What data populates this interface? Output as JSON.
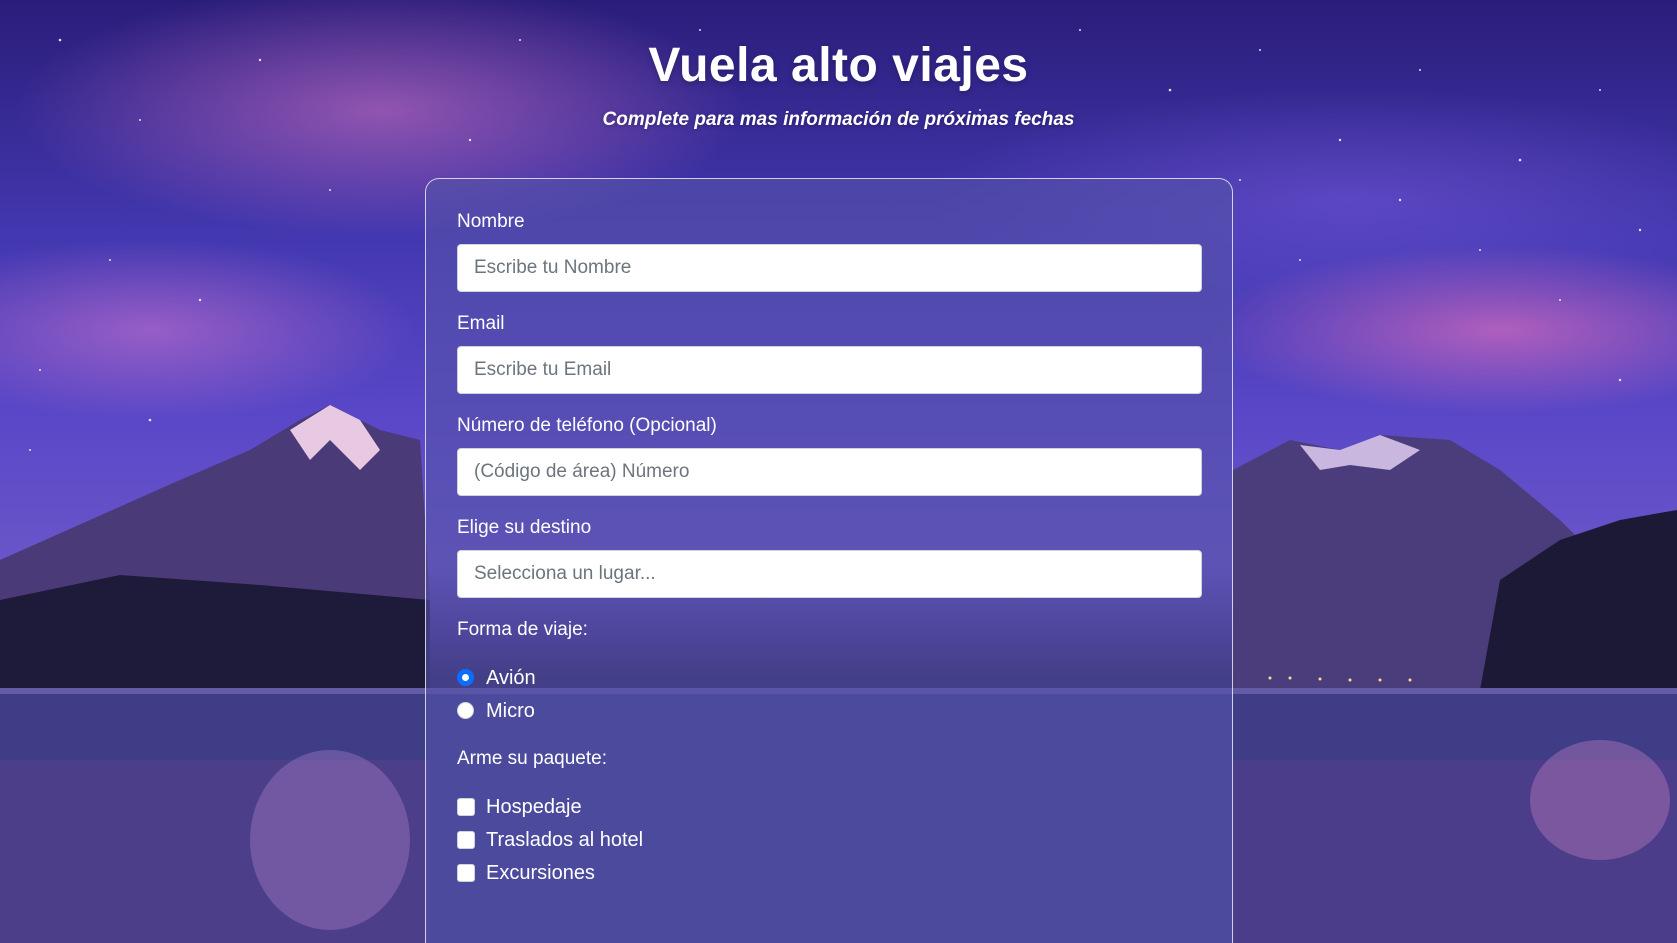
{
  "header": {
    "title": "Vuela alto viajes",
    "subtitle": "Complete para mas información de próximas fechas"
  },
  "form": {
    "name": {
      "label": "Nombre",
      "placeholder": "Escribe tu Nombre",
      "value": ""
    },
    "email": {
      "label": "Email",
      "placeholder": "Escribe tu Email",
      "value": ""
    },
    "phone": {
      "label": "Número de teléfono (Opcional)",
      "placeholder": "(Código de área) Número",
      "value": ""
    },
    "destination": {
      "label": "Elige su destino",
      "placeholder": "Selecciona un lugar...",
      "value": ""
    },
    "travel_mode": {
      "label": "Forma de viaje:",
      "options": [
        {
          "label": "Avión",
          "checked": true
        },
        {
          "label": "Micro",
          "checked": false
        }
      ]
    },
    "package": {
      "label": "Arme su paquete:",
      "options": [
        {
          "label": "Hospedaje",
          "checked": false
        },
        {
          "label": "Traslados al hotel",
          "checked": false
        },
        {
          "label": "Excursiones",
          "checked": false
        }
      ]
    }
  },
  "colors": {
    "radio_checked": "#0d6efd",
    "card_background": "rgba(85, 82, 170, 0.62)",
    "text": "#ffffff"
  },
  "background": {
    "icon": "mountain-lake-night-photo"
  }
}
